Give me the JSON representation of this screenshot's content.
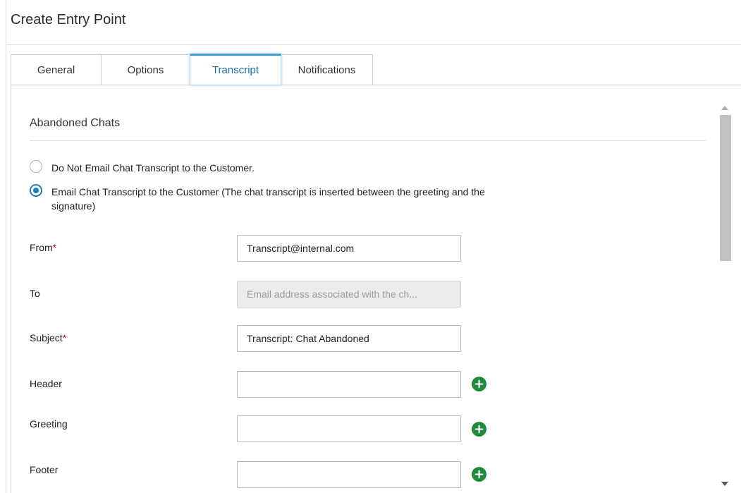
{
  "window": {
    "title": "Create Entry Point"
  },
  "tabs": [
    {
      "label": "General",
      "active": false
    },
    {
      "label": "Options",
      "active": false
    },
    {
      "label": "Transcript",
      "active": true
    },
    {
      "label": "Notifications",
      "active": false
    }
  ],
  "section": {
    "title": "Abandoned Chats"
  },
  "radios": [
    {
      "label": "Do Not Email Chat Transcript to the Customer.",
      "checked": false
    },
    {
      "label": "Email Chat Transcript to the Customer (The chat transcript is inserted between the greeting and the signature)",
      "checked": true
    }
  ],
  "fields": {
    "from": {
      "label": "From",
      "required_mark": "*",
      "value": "Transcript@internal.com"
    },
    "to": {
      "label": "To",
      "placeholder": "Email address associated with the ch..."
    },
    "subject": {
      "label": "Subject",
      "required_mark": "*",
      "value": "Transcript: Chat Abandoned"
    },
    "header": {
      "label": "Header",
      "value": ""
    },
    "greeting": {
      "label": "Greeting",
      "value": ""
    },
    "footer": {
      "label": "Footer",
      "value": ""
    }
  },
  "add_button": {
    "glyph": "+"
  },
  "colors": {
    "accent": "#1a7fc0",
    "add": "#1e8a3a",
    "required": "#d0021b"
  }
}
